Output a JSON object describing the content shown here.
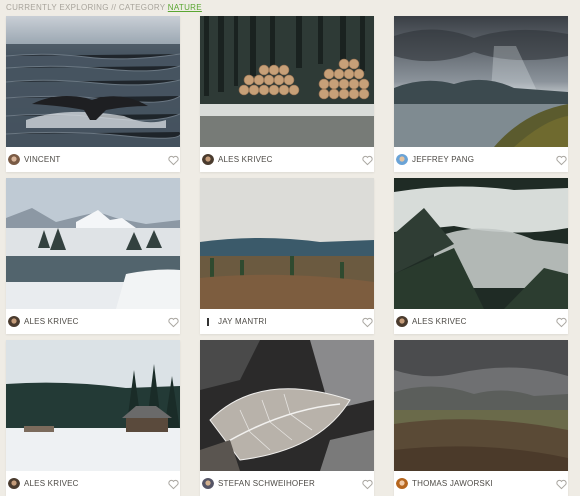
{
  "breadcrumb": {
    "prefix": "CURRENTLY EXPLORING // CATEGORY",
    "category": "NATURE"
  },
  "photos": [
    {
      "author": "VINCENT",
      "subject": "whale tail in sea",
      "avatar": "avatar-vincent"
    },
    {
      "author": "ALES KRIVEC",
      "subject": "stacked logs in snowy forest",
      "avatar": "avatar-ales-krivec"
    },
    {
      "author": "JEFFREY PANG",
      "subject": "stormy lake valley",
      "avatar": "avatar-jeffrey-pang"
    },
    {
      "author": "ALES KRIVEC",
      "subject": "snowy mountain lake",
      "avatar": "avatar-ales-krivec"
    },
    {
      "author": "JAY MANTRI",
      "subject": "autumn forest under cloudy sky",
      "avatar": "avatar-jay-mantri"
    },
    {
      "author": "ALES KRIVEC",
      "subject": "foggy forested valley",
      "avatar": "avatar-ales-krivec"
    },
    {
      "author": "ALES KRIVEC",
      "subject": "cabin in snowy pine forest",
      "avatar": "avatar-ales-krivec"
    },
    {
      "author": "STEFAN SCHWEIHOFER",
      "subject": "frosted leaves",
      "avatar": "avatar-stefan-schweihofer"
    },
    {
      "author": "THOMAS JAWORSKI",
      "subject": "moorland hills under cloudy sky",
      "avatar": "avatar-thomas-jaworski"
    }
  ],
  "icons": {
    "like": "heart-icon"
  }
}
